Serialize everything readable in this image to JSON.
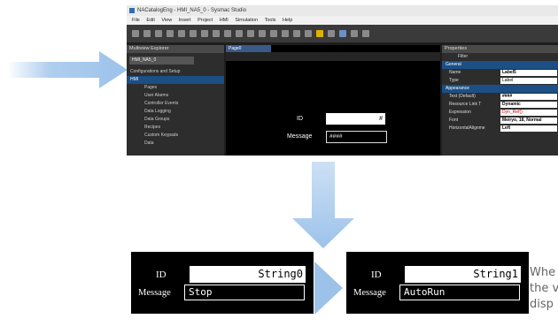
{
  "window": {
    "title": "NACatalogEng - HMI_NA5_0 - Sysmac Studio",
    "menu": [
      "File",
      "Edit",
      "View",
      "Insert",
      "Project",
      "HMI",
      "Simulation",
      "Tools",
      "Help"
    ]
  },
  "explorer": {
    "title": "Multiview Explorer",
    "device": "HMI_NA5_0",
    "items": [
      "Configurations and Setup",
      "HMI",
      "Pages",
      "User Alarms",
      "Controller Events",
      "Data Logging",
      "Data Groups",
      "Recipes",
      "Custom Keypads",
      "Data"
    ]
  },
  "editor": {
    "tab": "Page0",
    "id_label": "ID",
    "id_value": "#",
    "message_label": "Message",
    "message_value": "####"
  },
  "properties": {
    "title": "Properties",
    "filter_label": "Filter",
    "general_section": "General",
    "rows": [
      {
        "name": "Name",
        "value": "Label5"
      },
      {
        "name": "Type",
        "value": "Label"
      }
    ],
    "appearance_section": "Appearance",
    "text_rows": [
      {
        "name": "Text (Default)",
        "value": "####"
      },
      {
        "name": "Resource Link T",
        "value": "Dynamic"
      },
      {
        "name": "Expression",
        "value": "Dyn_Ref()"
      },
      {
        "name": "Font",
        "value": "Meiryo, 18, Normal"
      },
      {
        "name": "HorizontalAlignme",
        "value": "Left"
      }
    ]
  },
  "before": {
    "id_label": "ID",
    "id_value": "String0",
    "message_label": "Message",
    "message_value": "Stop"
  },
  "after": {
    "id_label": "ID",
    "id_value": "String1",
    "message_label": "Message",
    "message_value": "AutoRun"
  },
  "caption": {
    "line1": "Whe",
    "line2": "the v",
    "line3": "disp"
  },
  "colors": {
    "arrow": "#9cc2ea",
    "accent": "#1b4f86"
  }
}
